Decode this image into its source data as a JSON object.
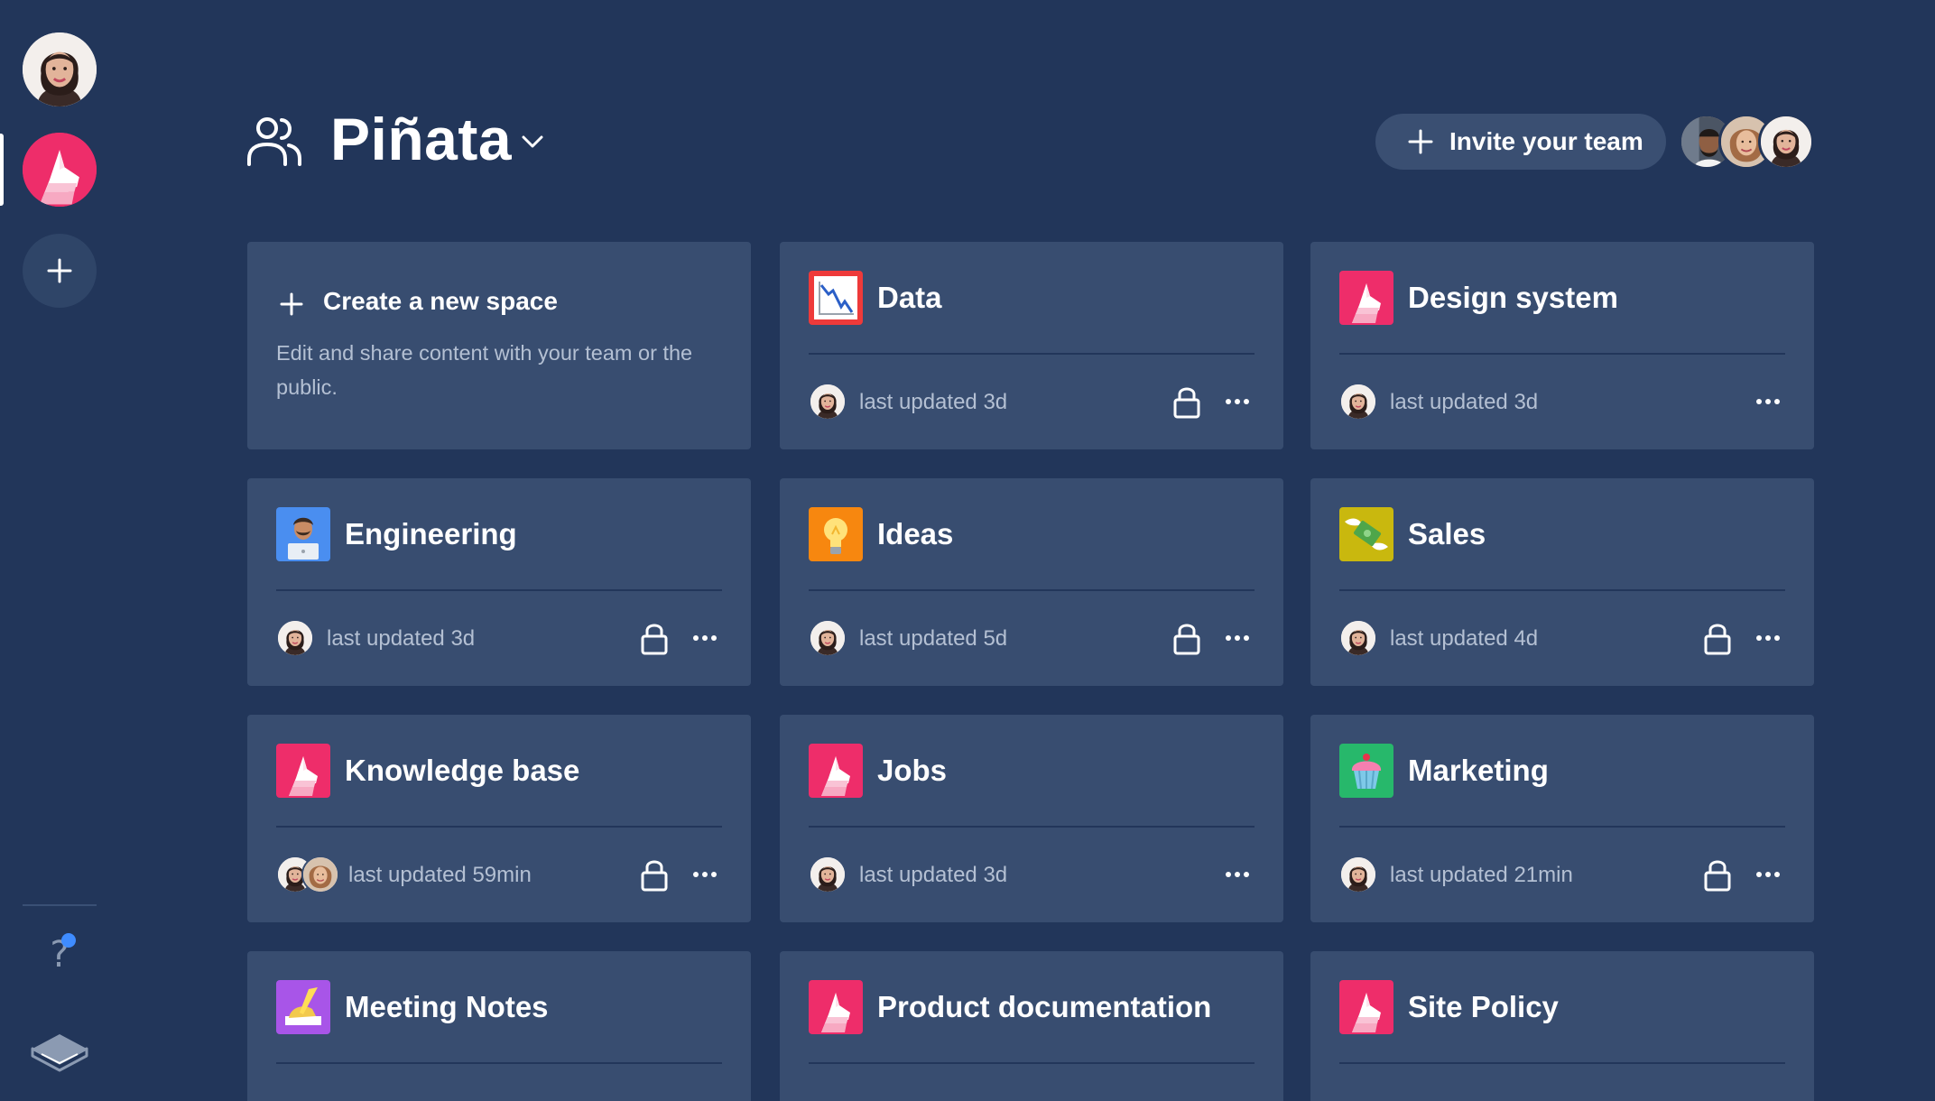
{
  "workspace": {
    "name": "Piñata"
  },
  "header": {
    "invite_label": "Invite your team"
  },
  "create_card": {
    "title": "Create a new space",
    "description": "Edit and share content with your team or the public."
  },
  "spaces": [
    {
      "title": "Data",
      "icon": "chart-down-icon",
      "updated": "last updated 3d",
      "locked": true
    },
    {
      "title": "Design system",
      "icon": "pinata-logo-icon",
      "updated": "last updated 3d",
      "locked": false
    },
    {
      "title": "Engineering",
      "icon": "technologist-icon",
      "updated": "last updated 3d",
      "locked": true
    },
    {
      "title": "Ideas",
      "icon": "lightbulb-icon",
      "updated": "last updated 5d",
      "locked": true
    },
    {
      "title": "Sales",
      "icon": "money-wings-icon",
      "updated": "last updated 4d",
      "locked": true
    },
    {
      "title": "Knowledge base",
      "icon": "pinata-logo-icon",
      "updated": "last updated 59min",
      "locked": true
    },
    {
      "title": "Jobs",
      "icon": "pinata-logo-icon",
      "updated": "last updated 3d",
      "locked": false
    },
    {
      "title": "Marketing",
      "icon": "cupcake-icon",
      "updated": "last updated 21min",
      "locked": true
    },
    {
      "title": "Meeting Notes",
      "icon": "writing-hand-icon",
      "updated": "",
      "locked": true
    },
    {
      "title": "Product documentation",
      "icon": "pinata-logo-icon",
      "updated": "",
      "locked": false
    },
    {
      "title": "Site Policy",
      "icon": "pinata-logo-icon",
      "updated": "",
      "locked": false
    }
  ],
  "sidebar": {
    "help_label": "?"
  },
  "colors": {
    "background": "#22365a",
    "card": "#384d70",
    "brand_pink": "#ee2d6a",
    "notification_blue": "#3f8cff"
  }
}
